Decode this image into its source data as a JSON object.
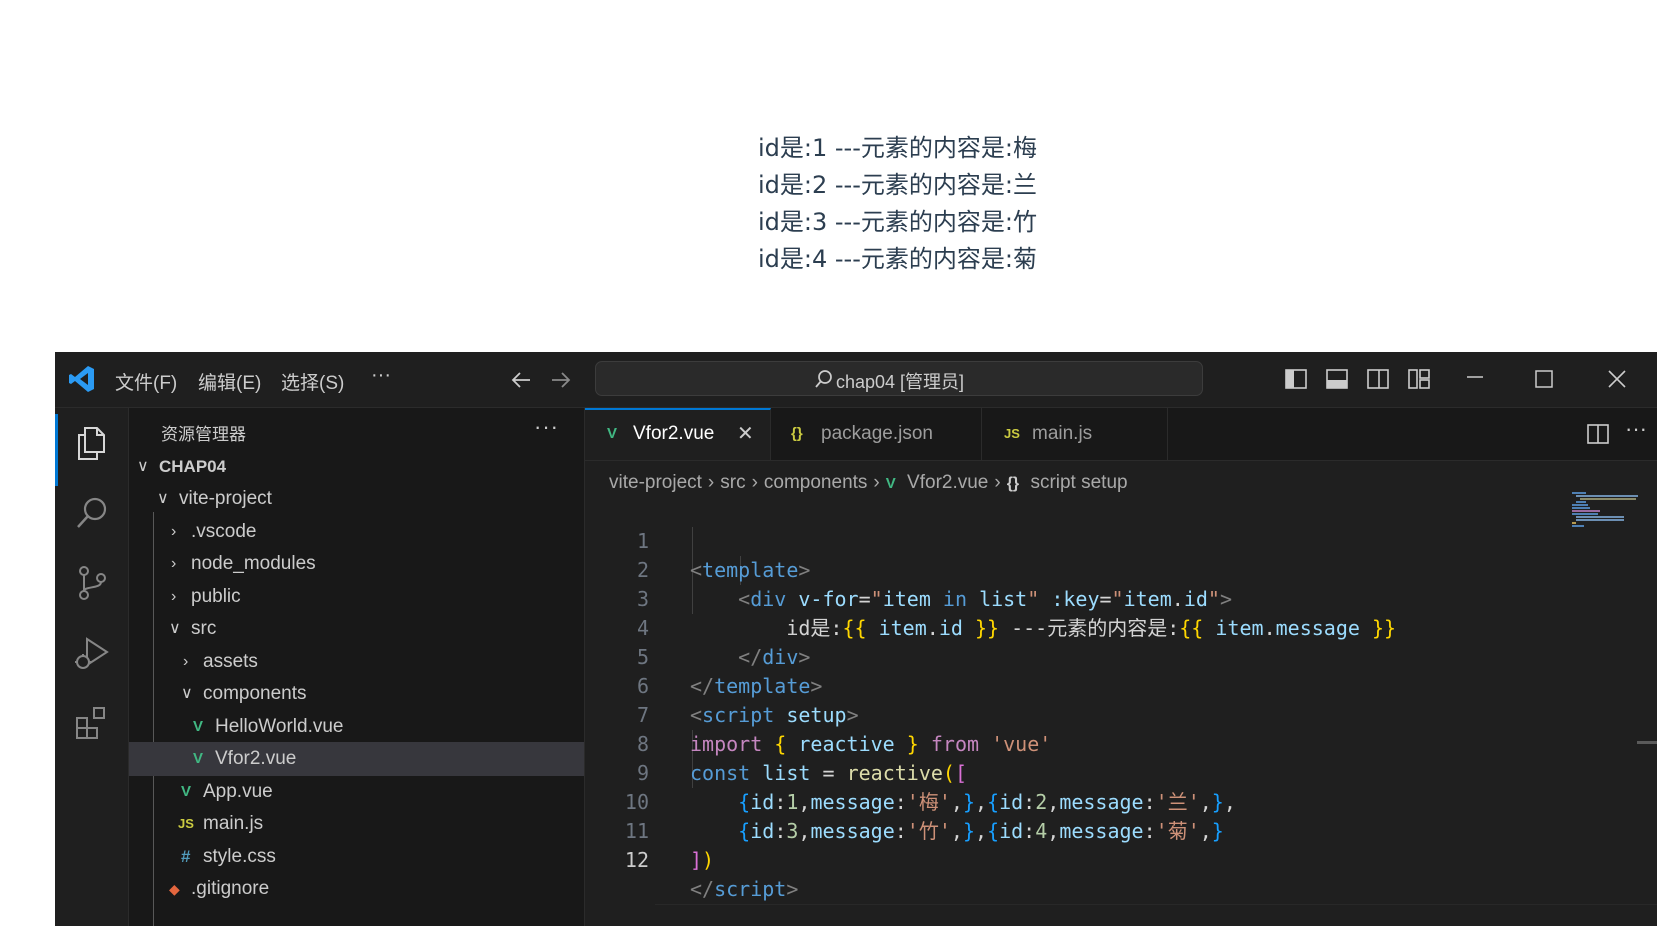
{
  "output": {
    "lines": [
      "id是:1 ---元素的内容是:梅",
      "id是:2 ---元素的内容是:兰",
      "id是:3 ---元素的内容是:竹",
      "id是:4 ---元素的内容是:菊"
    ]
  },
  "titlebar": {
    "menu": [
      "文件(F)",
      "编辑(E)",
      "选择(S)"
    ],
    "more": "···",
    "search": "chap04 [管理员]"
  },
  "sidebar": {
    "header": "资源管理器",
    "more": "···",
    "items": [
      {
        "label": "CHAP04"
      },
      {
        "label": "vite-project"
      },
      {
        "label": ".vscode"
      },
      {
        "label": "node_modules"
      },
      {
        "label": "public"
      },
      {
        "label": "src"
      },
      {
        "label": "assets"
      },
      {
        "label": "components"
      },
      {
        "label": "HelloWorld.vue"
      },
      {
        "label": "Vfor2.vue"
      },
      {
        "label": "App.vue"
      },
      {
        "label": "main.js"
      },
      {
        "label": "style.css"
      },
      {
        "label": ".gitignore"
      }
    ],
    "icon_js": "JS",
    "icon_css": "#",
    "icon_vue": "V"
  },
  "tabs": [
    {
      "label": "Vfor2.vue",
      "icon": "V"
    },
    {
      "label": "package.json",
      "icon": "{}"
    },
    {
      "label": "main.js",
      "icon": "JS"
    }
  ],
  "breadcrumb": [
    "vite-project",
    "src",
    "components",
    "Vfor2.vue",
    "script setup"
  ],
  "breadcrumb_icons": {
    "braces": "{}",
    "vue": "V"
  },
  "code": {
    "line_numbers": [
      "1",
      "2",
      "3",
      "4",
      "5",
      "6",
      "7",
      "8",
      "9",
      "10",
      "11",
      "12"
    ],
    "current_line": "12"
  },
  "colors": {
    "accent": "#0078d4",
    "vue_green": "#41b883",
    "js_yellow": "#cbcb41",
    "css_blue": "#519aba",
    "json_yellow": "#cbcb41"
  }
}
